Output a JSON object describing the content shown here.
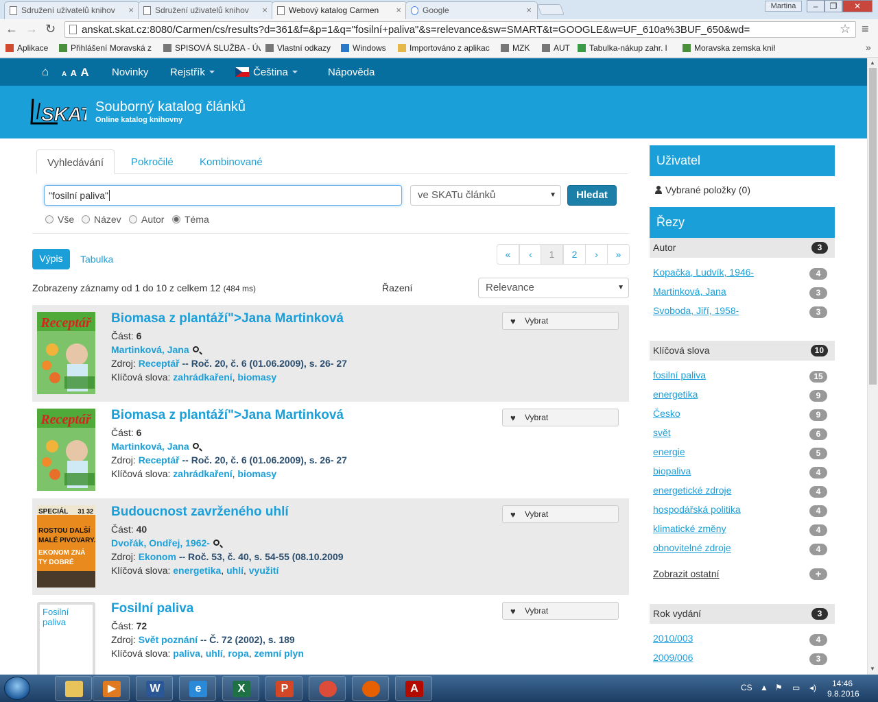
{
  "browser": {
    "tabs": [
      {
        "title": "Sdružení uživatelů knihov"
      },
      {
        "title": "Sdružení uživatelů knihov"
      },
      {
        "title": "Webový katalog Carmen"
      },
      {
        "title": "Google"
      }
    ],
    "tab_close": "×",
    "user": "Martina",
    "window_min": "–",
    "window_max": "❐",
    "window_close": "✕",
    "nav_back": "←",
    "nav_forward": "→",
    "nav_reload": "↻",
    "url": "anskat.skat.cz:8080/Carmen/cs/results?d=361&f=&p=1&q=\"fosilní+paliva\"&s=relevance&sw=SMART&t=GOOGLE&w=UF_610a%3BUF_650&wd=",
    "star": "☆",
    "menu": "≡",
    "bookmarks": [
      {
        "label": "Aplikace",
        "color": "#d04a2f"
      },
      {
        "label": "Přihlášení  Moravská z",
        "color": "#4a8f3c"
      },
      {
        "label": "SPISOVÁ SLUŽBA - Úv",
        "color": "#777777"
      },
      {
        "label": "Vlastní odkazy",
        "color": "#777777"
      },
      {
        "label": "Windows",
        "color": "#2a78c8"
      },
      {
        "label": "Importováno z aplikac",
        "color": "#e6b84a"
      },
      {
        "label": "MZK",
        "color": "#777777"
      },
      {
        "label": "AUT",
        "color": "#777777"
      },
      {
        "label": "Tabulka-nákup zahr. l",
        "color": "#3a9a45"
      },
      {
        "label": "Moravska zemska knih",
        "color": "#4a8f3c"
      }
    ],
    "bookmarks_more": "»"
  },
  "site": {
    "nav": {
      "home_icon": "⌂",
      "font_sizes": "A A A",
      "news": "Novinky",
      "index": "Rejstřík",
      "language": "Čeština",
      "help": "Nápověda"
    },
    "logo_text": "SKAT",
    "title": "Souborný katalog článků",
    "subtitle": "Online katalog knihovny"
  },
  "search": {
    "tabs": [
      "Vyhledávání",
      "Pokročilé",
      "Kombinované"
    ],
    "query": "\"fosilní paliva\"",
    "scope": "ve SKATu článků",
    "button": "Hledat",
    "fields": [
      "Vše",
      "Název",
      "Autor",
      "Téma"
    ],
    "selected_field": "Téma"
  },
  "results": {
    "views": {
      "list": "Výpis",
      "table": "Tabulka"
    },
    "pagination": [
      "«",
      "‹",
      "1",
      "2",
      "›",
      "»"
    ],
    "current_page": "1",
    "summary": "Zobrazeny záznamy od 1 do 10 z celkem 12",
    "timing": "(484 ms)",
    "sort_label": "Řazení",
    "sort_value": "Relevance",
    "select_label": "Vybrat",
    "part_label": "Část:",
    "source_label": "Zdroj:",
    "keywords_label": "Klíčová slova:",
    "records": [
      {
        "title": "Biomasa z plantáží\">Jana Martinková",
        "part": "6",
        "author": "Martinková, Jana",
        "source": "Receptář",
        "source_detail": "-- Roč. 20, č. 6 (01.06.2009), s. 26- 27",
        "keywords": [
          "zahrádkaření",
          "biomasy"
        ],
        "cover": "Receptář"
      },
      {
        "title": "Biomasa z plantáží\">Jana Martinková",
        "part": "6",
        "author": "Martinková, Jana",
        "source": "Receptář",
        "source_detail": "-- Roč. 20, č. 6 (01.06.2009), s. 26- 27",
        "keywords": [
          "zahrádkaření",
          "biomasy"
        ],
        "cover": "Receptář"
      },
      {
        "title": "Budoucnost zavrženého uhlí",
        "part": "40",
        "author": "Dvořák, Ondřej, 1962-",
        "source": "Ekonom",
        "source_detail": "-- Roč. 53, č. 40, s. 54-55 (08.10.2009",
        "keywords": [
          "energetika",
          "uhlí",
          "využití"
        ],
        "cover_lines": [
          "SPECIÁL",
          "ROSTOU DALŠÍ",
          "MALÉ PIVOVARY.",
          "EKONOM ZNÁ",
          "TY DOBRÉ"
        ],
        "cover_issue": "31 32"
      },
      {
        "title": "Fosilní paliva",
        "part": "72",
        "source": "Svět poznání",
        "source_detail": "-- Č. 72 (2002), s. 189",
        "keywords": [
          "paliva",
          "uhlí",
          "ropa",
          "zemní plyn"
        ],
        "cover_text": "Fosilní paliva"
      }
    ]
  },
  "sidebar": {
    "user_heading": "Uživatel",
    "selected_items": "Vybrané položky (0)",
    "facets_heading": "Řezy",
    "author": {
      "label": "Autor",
      "count": "3",
      "items": [
        {
          "label": "Kopačka, Ludvík, 1946-",
          "count": "4"
        },
        {
          "label": "Martinková, Jana",
          "count": "3"
        },
        {
          "label": "Svoboda, Jiří, 1958-",
          "count": "3"
        }
      ]
    },
    "keywords": {
      "label": "Klíčová slova",
      "count": "10",
      "items": [
        {
          "label": "fosilní paliva",
          "count": "15"
        },
        {
          "label": "energetika",
          "count": "9"
        },
        {
          "label": "Česko",
          "count": "9"
        },
        {
          "label": "svět",
          "count": "6"
        },
        {
          "label": "energie",
          "count": "5"
        },
        {
          "label": "biopaliva",
          "count": "4"
        },
        {
          "label": "energetické zdroje",
          "count": "4"
        },
        {
          "label": "hospodářská politika",
          "count": "4"
        },
        {
          "label": "klimatické změny",
          "count": "4"
        },
        {
          "label": "obnovitelné zdroje",
          "count": "4"
        }
      ],
      "show_more": "Zobrazit ostatní",
      "show_more_icon": "+"
    },
    "year": {
      "label": "Rok vydání",
      "count": "3",
      "items": [
        {
          "label": "2010/003",
          "count": "4"
        },
        {
          "label": "2009/006",
          "count": "3"
        }
      ]
    }
  },
  "taskbar": {
    "apps": [
      {
        "name": "explorer",
        "glyph": "",
        "color": "#e8c25a"
      },
      {
        "name": "media-player",
        "glyph": "▶",
        "color": "#e07a20"
      },
      {
        "name": "word",
        "glyph": "W",
        "color": "#2b5797"
      },
      {
        "name": "internet-explorer",
        "glyph": "e",
        "color": "#2a8ad8"
      },
      {
        "name": "excel",
        "glyph": "X",
        "color": "#1e7145"
      },
      {
        "name": "powerpoint",
        "glyph": "P",
        "color": "#d24726"
      },
      {
        "name": "chrome",
        "glyph": "",
        "color": "#dd4b39"
      },
      {
        "name": "firefox",
        "glyph": "",
        "color": "#e66000"
      },
      {
        "name": "acrobat",
        "glyph": "A",
        "color": "#b30b00"
      }
    ],
    "language": "CS",
    "time": "14:46",
    "date": "9.8.2016"
  }
}
